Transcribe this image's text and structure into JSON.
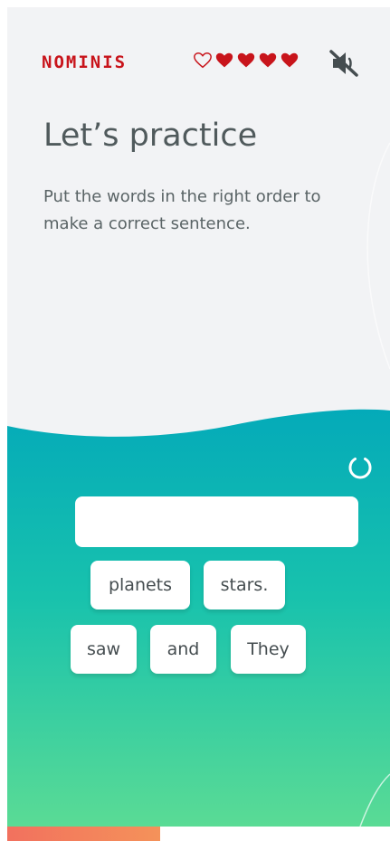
{
  "app": {
    "logo": "NOMINIS",
    "brand_color": "#c8141b",
    "lives": {
      "total": 5,
      "remaining": 4
    },
    "sound": {
      "muted": true,
      "icon": "speaker-muted-icon"
    }
  },
  "lesson": {
    "title": "Let’s practice",
    "instruction": "Put the words in the right order to make a correct sentence."
  },
  "exercise": {
    "answer_text": "",
    "reset_icon": "reset-icon",
    "words": [
      {
        "label": "planets"
      },
      {
        "label": "stars."
      },
      {
        "label": "saw"
      },
      {
        "label": "and"
      },
      {
        "label": "They"
      }
    ]
  },
  "progress": {
    "fraction": 0.4
  },
  "colors": {
    "top_bg": "#f2f3f5",
    "gradient_top": "#04aab9",
    "gradient_bottom": "#5adb95",
    "progress": "#f2715e"
  }
}
